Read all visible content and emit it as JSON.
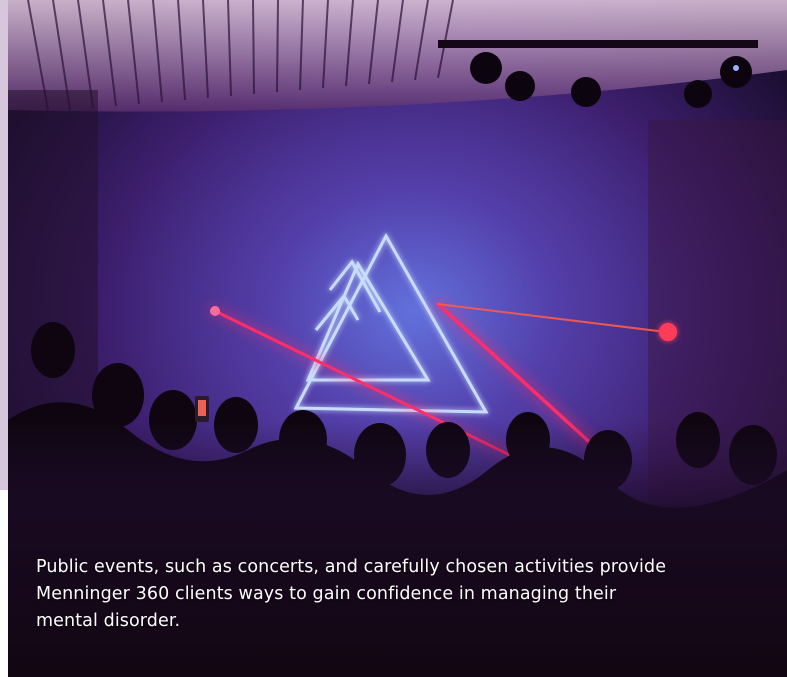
{
  "caption": {
    "text": "Public events, such as concerts, and carefully chosen activities provide Menninger 360 clients ways to gain confidence in managing their mental disorder."
  },
  "photo": {
    "subject": "concert-laser-show",
    "colors": {
      "background": "#1a0d2e",
      "haze_purple": "#5a2a8a",
      "haze_blue": "#3a4ab8",
      "laser_red": "#ff2d6a",
      "triangle_blue": "#b8d4ff",
      "side_strip": "#d7c7dc"
    }
  }
}
